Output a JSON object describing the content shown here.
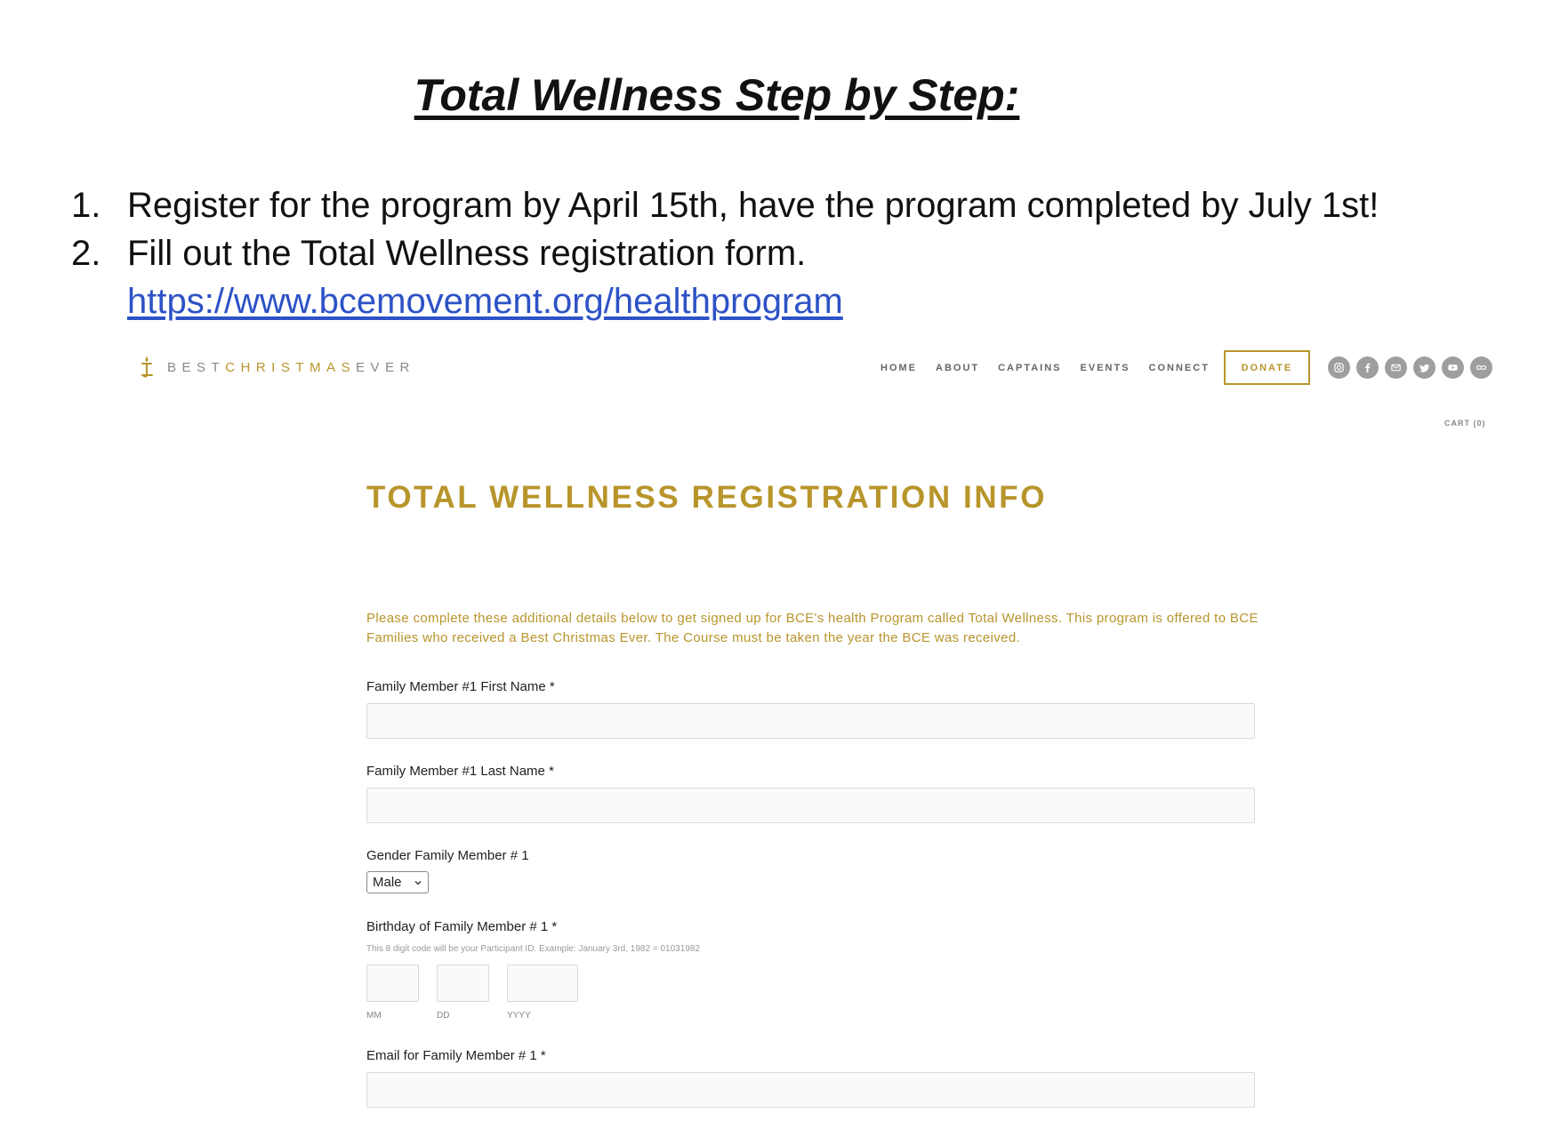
{
  "document": {
    "title": "Total Wellness Step by Step:",
    "steps": [
      {
        "number": "1.",
        "text": "Register for the program by April 15th, have the program completed by July 1st!"
      },
      {
        "number": "2.",
        "text": "Fill out the Total Wellness registration form.",
        "link": "https://www.bcemovement.org/healthprogram"
      }
    ]
  },
  "site": {
    "logo": {
      "part1": "BEST",
      "part2": "CHRISTMAS",
      "part3": "EVER",
      "icon": "candle-icon"
    },
    "nav": {
      "items": [
        "HOME",
        "ABOUT",
        "CAPTAINS",
        "EVENTS",
        "CONNECT"
      ],
      "donate": "DONATE",
      "socials": [
        "instagram-icon",
        "facebook-icon",
        "email-icon",
        "twitter-icon",
        "youtube-icon",
        "link-icon"
      ]
    },
    "cart": "CART (0)",
    "heading": "TOTAL WELLNESS REGISTRATION INFO",
    "intro": "Please complete these additional details below to get signed up for BCE's health Program called Total Wellness.  This program is offered to BCE Families who received a Best Christmas Ever.  The Course must be taken the year the BCE was received.",
    "form": {
      "first_name_label": "Family Member #1 First Name *",
      "first_name_value": "",
      "last_name_label": "Family Member #1 Last Name *",
      "last_name_value": "",
      "gender_label": "Gender Family Member # 1",
      "gender_value": "Male",
      "birthday_label": "Birthday of Family Member # 1 *",
      "birthday_hint": "This 8 digit code will be your Participant ID.  Example: January 3rd, 1982 = 01031982",
      "mm": "MM",
      "dd": "DD",
      "yyyy": "YYYY",
      "email_label": "Email for Family Member # 1 *",
      "email_value": ""
    },
    "colors": {
      "gold": "#b8952b",
      "link_blue": "#2d52c6",
      "icon_grey": "#9e9e9e"
    }
  }
}
